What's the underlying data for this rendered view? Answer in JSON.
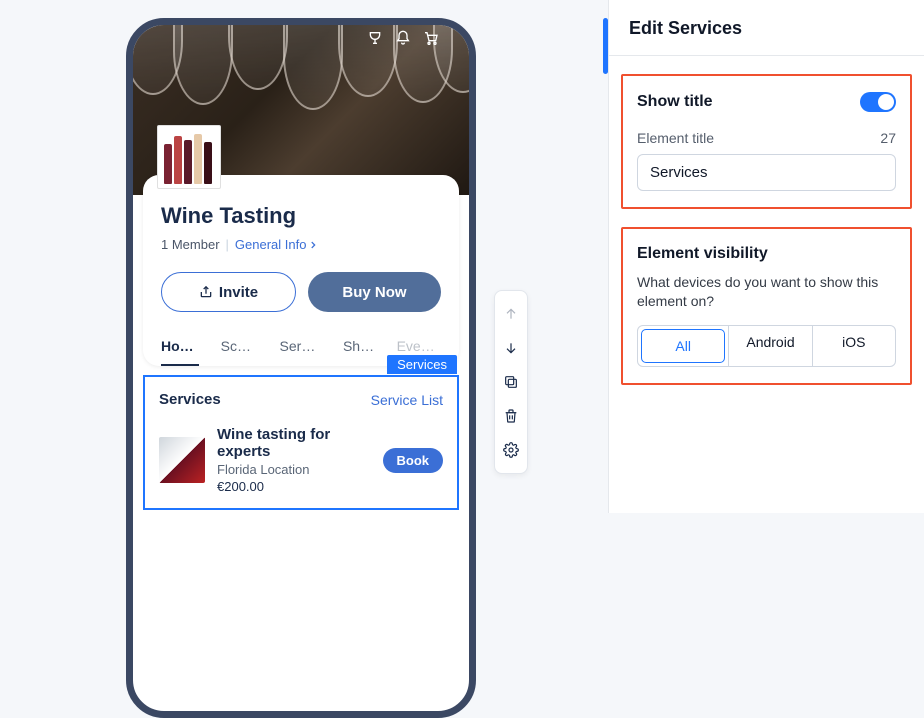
{
  "panel": {
    "title": "Edit Services",
    "showTitle": {
      "label": "Show title",
      "enabled": true
    },
    "elementTitle": {
      "label": "Element title",
      "counter": "27",
      "value": "Services"
    },
    "visibility": {
      "label": "Element visibility",
      "desc": "What devices do you want to show this element on?",
      "options": [
        "All",
        "Android",
        "iOS"
      ],
      "active": "All"
    }
  },
  "preview": {
    "groupTitle": "Wine Tasting",
    "members": "1 Member",
    "infoLink": "General Info",
    "inviteLabel": "Invite",
    "buyLabel": "Buy Now",
    "tabs": [
      "Home",
      "Schedule",
      "Services",
      "Shop",
      "Events"
    ],
    "activeTab": "Home",
    "servicesTag": "Services",
    "servicesHeading": "Services",
    "serviceListLink": "Service List",
    "service": {
      "title": "Wine tasting for experts",
      "location": "Florida Location",
      "price": "€200.00",
      "bookLabel": "Book"
    }
  }
}
